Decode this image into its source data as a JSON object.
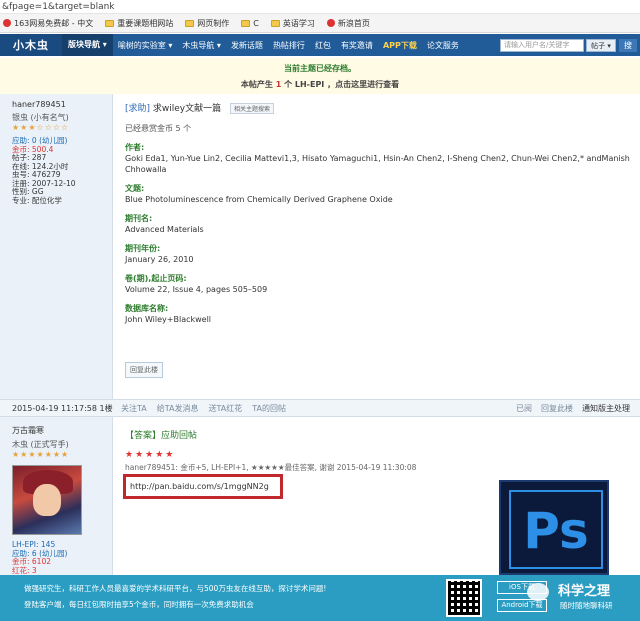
{
  "browser": {
    "url": "&fpage=1&target=blank"
  },
  "favorites": [
    {
      "label": "163网易免费邮 - 中文",
      "icon": "netease-icon"
    },
    {
      "label": "重要课题相网站",
      "icon": "folder-icon"
    },
    {
      "label": "网页制作",
      "icon": "folder-icon"
    },
    {
      "label": "C",
      "icon": "folder-icon"
    },
    {
      "label": "英语学习",
      "icon": "folder-icon"
    },
    {
      "label": "新浪首页",
      "icon": "sina-icon"
    }
  ],
  "nav": {
    "logo": "小木虫",
    "first": "版块导航 ▾",
    "items": [
      "喻树的实验室 ▾",
      "木虫导航 ▾",
      "发新话题",
      "热帖排行",
      "红包",
      "有奖邀请"
    ],
    "app": "APP下载",
    "last": "论文服务",
    "search_placeholder": "请输入用户名/关键字",
    "topic_select": "帖子 ▾",
    "go": "搜"
  },
  "notice": {
    "line1": "当前主题已经存档。",
    "line2_pre": "本帖产生 ",
    "line2_num": "1",
    "line2_post": " 个 LH-EPI ，点击这里进行查看"
  },
  "post1": {
    "user": {
      "name": "haner789451",
      "rank": "银虫 (小有名气)",
      "stars": "★★★☆☆☆☆",
      "stats": [
        {
          "text": "应助: 0 (幼儿园)",
          "style": "blue"
        },
        {
          "text": "金币: 500.4",
          "style": "red"
        },
        {
          "text": "帖子: 287",
          "style": ""
        },
        {
          "text": "在线: 124.2小时",
          "style": ""
        },
        {
          "text": "虫号: 476279",
          "style": ""
        },
        {
          "text": "注册: 2007-12-10",
          "style": ""
        },
        {
          "text": "性别: GG",
          "style": ""
        },
        {
          "text": "专业: 配位化学",
          "style": ""
        }
      ]
    },
    "tag": "[求助]",
    "title": "求wiley文献一篇",
    "similar_btn": "相关主题搜索",
    "reward": "已经悬赏金币 5 个",
    "fields": [
      {
        "label": "作者:",
        "value": "Goki Eda1, Yun-Yue Lin2, Cecilia Mattevi1,3, Hisato Yamaguchi1, Hsin-An Chen2, I-Sheng Chen2, Chun-Wei Chen2,* andManish Chhowalla"
      },
      {
        "label": "文题:",
        "value": "Blue Photoluminescence from Chemically Derived Graphene Oxide"
      },
      {
        "label": "期刊名:",
        "value": "Advanced Materials"
      },
      {
        "label": "期刊年份:",
        "value": "January 26, 2010"
      },
      {
        "label": "卷(期),起止页码:",
        "value": "Volume 22, Issue 4, pages 505–509"
      },
      {
        "label": "数据库名称:",
        "value": "John Wiley+Blackwell"
      }
    ],
    "reply_btn": "回复此楼"
  },
  "footer": {
    "date": "2015-04-19 11:17:58 1楼",
    "actions": [
      "关注TA",
      "给TA发消息",
      "送TA红花",
      "TA的回帖"
    ],
    "right": [
      "已阅",
      "回复此楼",
      "通知版主处理"
    ]
  },
  "post2": {
    "user": {
      "name": "万古霜寒",
      "rank": "木虫 (正式写手)",
      "stars": "★★★★★★★",
      "stats": [
        {
          "text": "LH-EPI: 145",
          "style": "blue"
        },
        {
          "text": "应助: 6 (幼儿园)",
          "style": "blue"
        },
        {
          "text": "金币: 6102",
          "style": "red"
        },
        {
          "text": "红花: 3",
          "style": "red"
        }
      ]
    },
    "title": "【答案】应助回帖",
    "stars": "★★★★★",
    "rate_line": "haner789451: 金币+5, LH-EPI+1, ★★★★★最佳答案, 谢谢 2015-04-19 11:30:08",
    "link": "http://pan.baidu.com/s/1mggNN2g",
    "ps_text": "Ps"
  },
  "banner": {
    "line1": "做强研究生，科研工作人员最喜爱的学术科研平台，与500万虫友在线互助，探讨学术问题!",
    "line2": "登陆客户端，每日红包限时抽享5个金币，同时拥有一次免费求助机会",
    "ios": "iOS下载",
    "android": "Android下载",
    "brand": "科学之理",
    "brand_sub": "随时随地聊科研"
  }
}
